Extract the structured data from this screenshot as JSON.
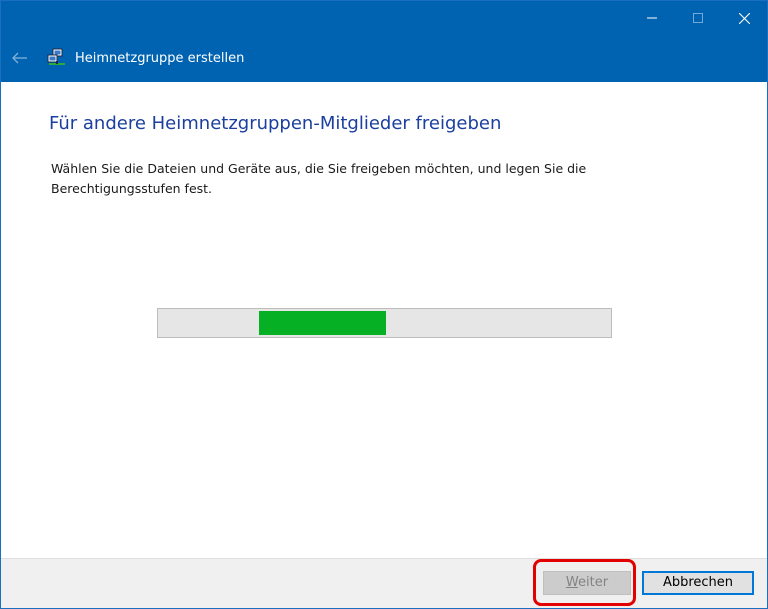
{
  "window": {
    "title": "Heimnetzgruppe erstellen",
    "icons": {
      "back": "back-arrow-icon",
      "app": "homegroup-network-icon",
      "minimize": "minimize-icon",
      "maximize": "maximize-icon",
      "close": "close-icon"
    }
  },
  "content": {
    "heading": "Für andere Heimnetzgruppen-Mitglieder freigeben",
    "description": "Wählen Sie die Dateien und Geräte aus, die Sie freigeben möchten, und legen Sie die Berechtigungsstufen fest.",
    "progress": {
      "state": "indeterminate",
      "color": "#06b025"
    }
  },
  "footer": {
    "next_label_mnemonic": "W",
    "next_label_rest": "eiter",
    "next_enabled": false,
    "cancel_label": "Abbrechen"
  },
  "colors": {
    "titlebar": "#0063b1",
    "heading": "#1b3fa0",
    "highlight": "#e30000"
  }
}
